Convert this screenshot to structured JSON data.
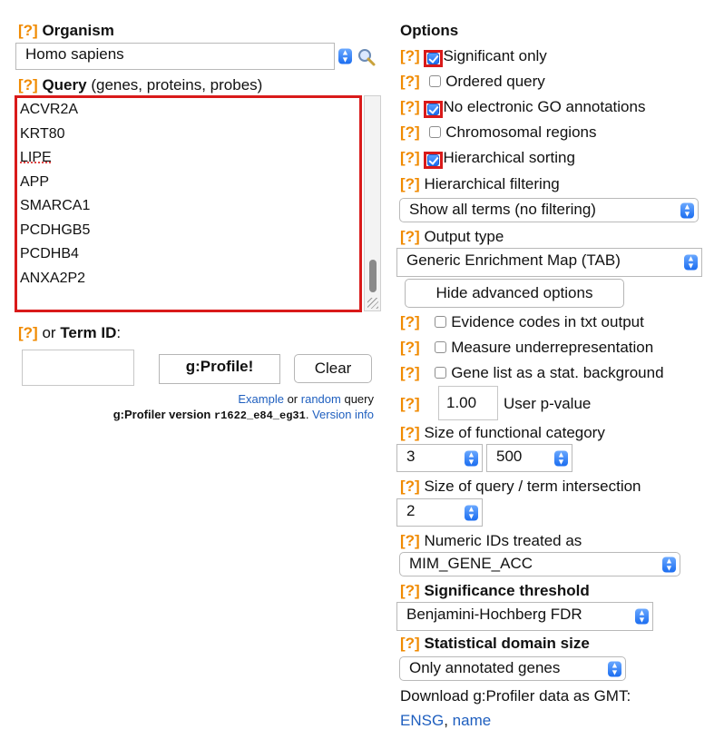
{
  "left": {
    "help": "[?]",
    "organism_label": "Organism",
    "organism_value": "Homo sapiens",
    "query_label": "Query",
    "query_sub": "(genes, proteins, probes)",
    "query_lines": [
      "ACVR2A",
      "KRT80",
      "LIPE",
      "APP",
      "SMARCA1",
      "PCDHGB5",
      "PCDHB4",
      "ANXA2P2"
    ],
    "or_label": "or",
    "term_id_label": "Term ID",
    "term_id_colon": ":",
    "profile_button": "g:Profile!",
    "clear_button": "Clear",
    "example_link": "Example",
    "or_word": "or",
    "random_link": "random",
    "query_word": "query",
    "version_prefix": "g:Profiler version",
    "version_code": "r1622_e84_eg31",
    "version_dot": ".",
    "version_info_link": "Version info"
  },
  "right": {
    "options_title": "Options",
    "help": "[?]",
    "significant_only": "Significant only",
    "ordered_query": "Ordered query",
    "no_electronic_go": "No electronic GO annotations",
    "chromosomal_regions": "Chromosomal regions",
    "hierarchical_sorting": "Hierarchical sorting",
    "hierarchical_filtering_label": "Hierarchical filtering",
    "hierarchical_filtering_value": "Show all terms (no filtering)",
    "output_type_label": "Output type",
    "output_type_value": "Generic Enrichment Map (TAB)",
    "hide_advanced_button": "Hide advanced options",
    "evidence_codes": "Evidence codes in txt output",
    "measure_under": "Measure underrepresentation",
    "gene_list_bg": "Gene list as a stat. background",
    "pvalue_value": "1.00",
    "pvalue_label": "User p-value",
    "size_func_label": "Size of functional category",
    "size_func_min": "3",
    "size_func_max": "500",
    "size_inter_label": "Size of query / term intersection",
    "size_inter_value": "2",
    "numeric_ids_label": "Numeric IDs treated as",
    "numeric_ids_value": "MIM_GENE_ACC",
    "sig_threshold_label": "Significance threshold",
    "sig_threshold_value": "Benjamini-Hochberg FDR",
    "stat_domain_label": "Statistical domain size",
    "stat_domain_value": "Only annotated genes",
    "download_label": "Download g:Profiler data as GMT:",
    "ensg_link": "ENSG",
    "comma": ",",
    "name_link": "name"
  },
  "colors": {
    "help": "#f08a00",
    "highlight": "#d91a1a",
    "link": "#1f5fbf",
    "select_arrow": "#1b6df0"
  },
  "icons": {
    "search": "search-icon",
    "select_arrow": "updown-arrow-icon",
    "checkbox_checked": "checkbox-checked-icon"
  }
}
